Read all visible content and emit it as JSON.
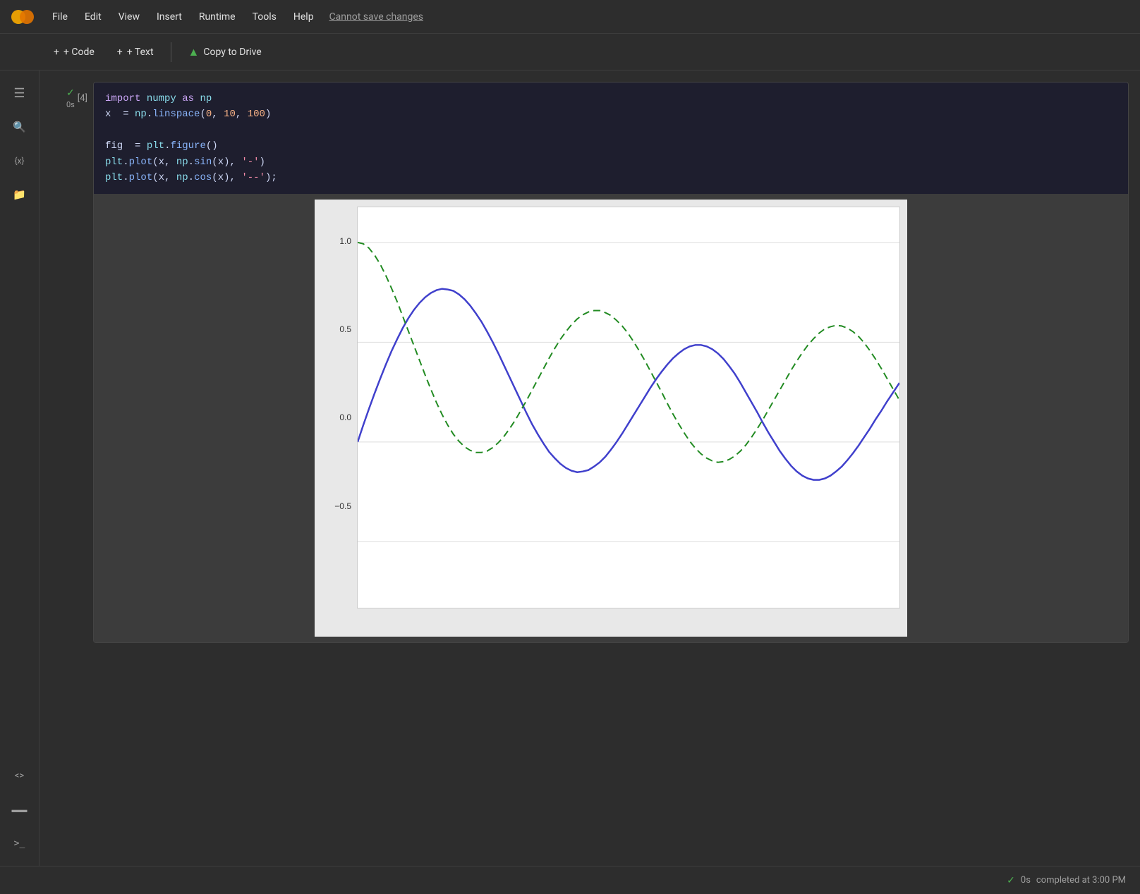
{
  "app": {
    "title": "Google Colab"
  },
  "menubar": {
    "items": [
      "File",
      "Edit",
      "View",
      "Insert",
      "Runtime",
      "Tools",
      "Help"
    ],
    "cannot_save": "Cannot save changes"
  },
  "toolbar": {
    "code_label": "+ Code",
    "text_label": "+ Text",
    "copy_to_drive_label": "Copy to Drive"
  },
  "sidebar": {
    "icons": [
      {
        "name": "menu-icon",
        "symbol": "☰"
      },
      {
        "name": "search-icon",
        "symbol": "🔍"
      },
      {
        "name": "variables-icon",
        "symbol": "{x}"
      },
      {
        "name": "files-icon",
        "symbol": "📁"
      },
      {
        "name": "code-editor-icon",
        "symbol": "<>"
      },
      {
        "name": "terminal-icon",
        "symbol": "▬"
      },
      {
        "name": "console-icon",
        "symbol": ">_"
      }
    ]
  },
  "cell": {
    "number": "[4]",
    "status_check": "✓",
    "status_time": "0s",
    "code_lines": [
      "import numpy as np",
      "x = np.linspace(0, 10, 100)",
      "",
      "fig = plt.figure()",
      "plt.plot(x, np.sin(x), '-')",
      "plt.plot(x, np.cos(x), '--');"
    ]
  },
  "plot": {
    "y_labels": [
      "1.0",
      "0.5",
      "0.0",
      "-0.5"
    ],
    "y_positions": [
      8,
      30,
      52,
      74
    ]
  },
  "statusbar": {
    "check": "✓",
    "time": "0s",
    "completed": "completed at 3:00 PM"
  }
}
